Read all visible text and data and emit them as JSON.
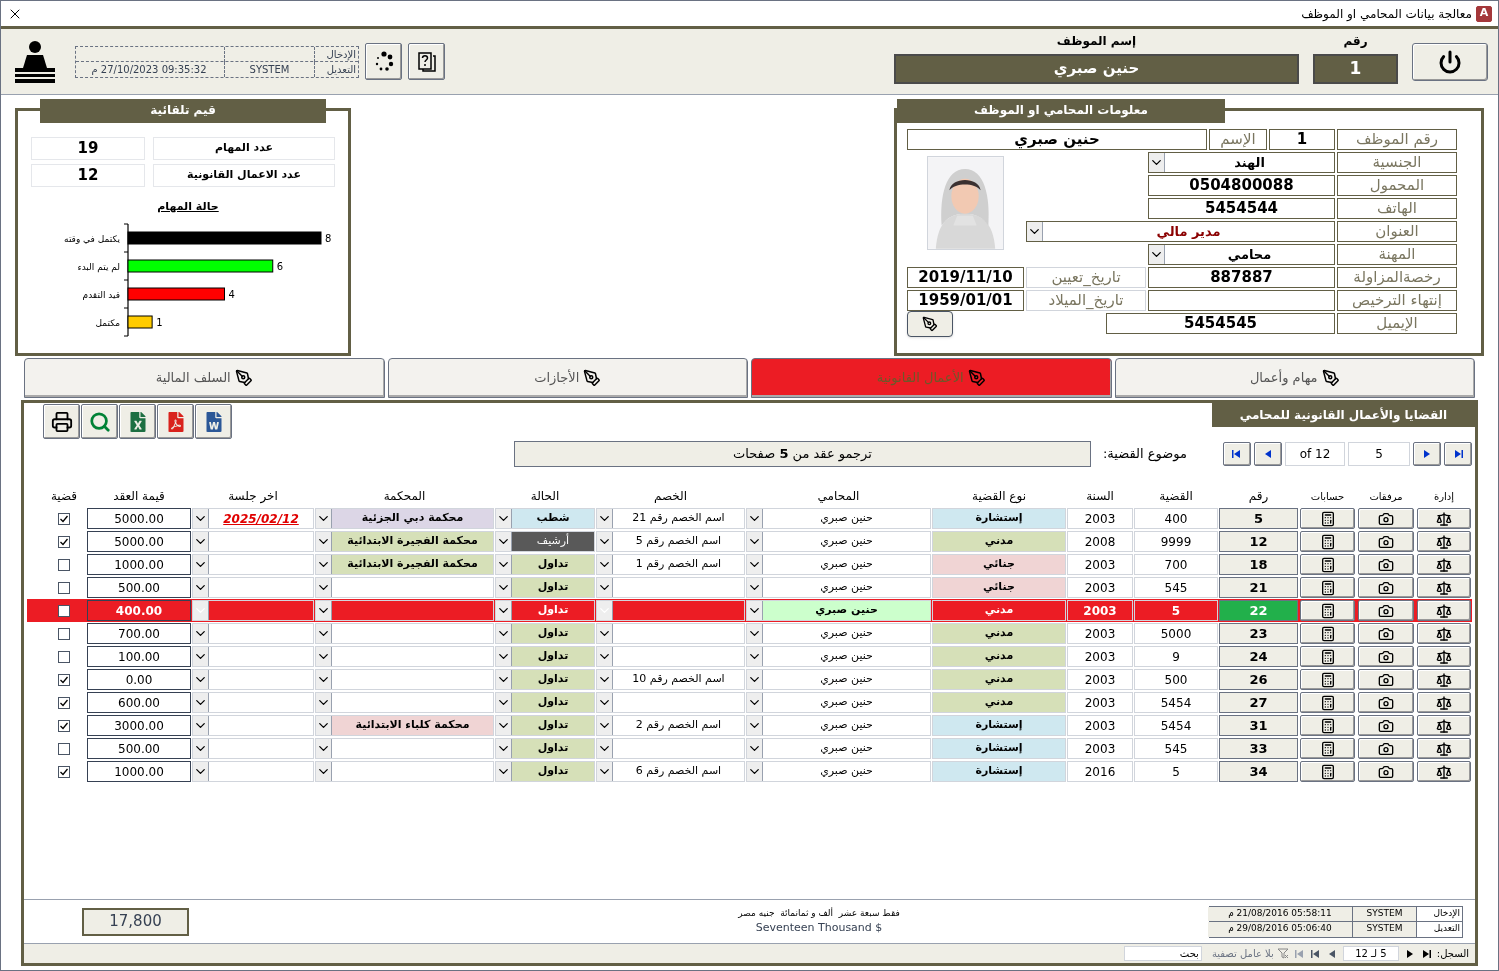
{
  "window": {
    "icon_letter": "A",
    "title": "معالجة بيانات المحامي او الموظف"
  },
  "header": {
    "number_label": "رقم",
    "number": "1",
    "name_label": "إسم الموظف",
    "name": "حنين صبري",
    "audit": [
      {
        "label": "الإدخال"
      },
      {
        "label": "التعديل",
        "user": "SYSTEM",
        "time": "09:35:32 27/10/2023 م"
      }
    ]
  },
  "stats_panel": {
    "title": "قيم تلقائية",
    "stats": [
      {
        "label": "عدد المهام",
        "value": "19"
      },
      {
        "label": "عدد الاعمال القانونية",
        "value": "12"
      }
    ],
    "chart_data": {
      "type": "bar",
      "orientation": "horizontal",
      "title": "حالة المهام",
      "categories": [
        "يكتمل في وقته",
        "لم يتم البدء",
        "قيد التقدم",
        "مكتمل"
      ],
      "series": [
        {
          "values": [
            8,
            6,
            4,
            1
          ]
        }
      ],
      "colors": [
        "#000000",
        "#00ff00",
        "#ff0000",
        "#ffcc00"
      ],
      "data_labels": true
    }
  },
  "employee_panel": {
    "title": "معلومات المحامي او الموظف",
    "id": {
      "label": "رقم الموظف",
      "value": "1"
    },
    "name": {
      "label": "الإسم",
      "value": "حنين صبري"
    },
    "nationality": {
      "label": "الجنسية",
      "value": "الهند"
    },
    "mobile": {
      "label": "المحمول",
      "value": "0504800088"
    },
    "phone": {
      "label": "الهاتف",
      "value": "5454544"
    },
    "address": {
      "label": "العنوان",
      "value": "مدير مالي"
    },
    "profession": {
      "label": "المهنة",
      "value": "محامي"
    },
    "license": {
      "label": "رخصةالمزاولة",
      "value": "887887"
    },
    "license_expiry": {
      "label": "إنتهاء الترخيص"
    },
    "email": {
      "label": "الإيميل",
      "value": "5454545"
    },
    "hire_date": {
      "label": "تاريخ_تعيين",
      "value": "2019/11/10"
    },
    "birth_date": {
      "label": "تاريخ_الميلاد",
      "value": "1959/01/01"
    }
  },
  "tabs": [
    {
      "label": "مهام وأعمال",
      "selected": false
    },
    {
      "label": "الأعمال القانونية",
      "selected": true
    },
    {
      "label": "الأجازات",
      "selected": false
    },
    {
      "label": "السلف المالية",
      "selected": false
    }
  ],
  "cases": {
    "title": "القضايا والأعمال القانونية للمحامي",
    "pager": {
      "of": "of 12",
      "current": "5"
    },
    "subject": {
      "label": "موضوع القضية:",
      "value": "ترجمو عقد من **5** صفحات"
    },
    "columns": [
      "إدارة",
      "مرفقات",
      "حسابات",
      "رقم",
      "القضية",
      "السنة",
      "نوع القضية",
      "المحامي",
      "الخصم",
      "الحالة",
      "المحكمة",
      "اخر جلسة",
      "قيمة العقد",
      "قضية"
    ],
    "rows": [
      {
        "number": "5",
        "case": "400",
        "year": "2003",
        "type": {
          "text": "إستشارة",
          "color": "#cfe8f0"
        },
        "lawyer": "حنين صبري",
        "opponent": "اسم الخصم رقم 21",
        "status": {
          "text": "شطب",
          "color": "#cfe8f0"
        },
        "court": {
          "text": "محكمة دبي الجزئية",
          "color": "#dcd6e6"
        },
        "last_session": "2025/02/12",
        "value": "5000.00",
        "checked": true,
        "selected": false
      },
      {
        "number": "12",
        "case": "9999",
        "year": "2008",
        "type": {
          "text": "مدني",
          "color": "#d6e0b8"
        },
        "lawyer": "حنين صبري",
        "opponent": "اسم الخصم رقم 5",
        "status": {
          "text": "أرشيف",
          "color": "#595959"
        },
        "court": {
          "text": "محكمة الفجيرة الابتدائية",
          "color": "#d6e0b8"
        },
        "value": "5000.00",
        "checked": true,
        "selected": false
      },
      {
        "number": "18",
        "case": "700",
        "year": "2003",
        "type": {
          "text": "جنائي",
          "color": "#f0d4d4"
        },
        "lawyer": "حنين صبري",
        "opponent": "اسم الخصم رقم 1",
        "status": {
          "text": "تداول",
          "color": "#d6e0b8"
        },
        "court": {
          "text": "محكمة الفجيرة الابتدائية",
          "color": "#d6e0b8"
        },
        "value": "1000.00",
        "checked": false,
        "selected": false
      },
      {
        "number": "21",
        "case": "545",
        "year": "2003",
        "type": {
          "text": "جنائي",
          "color": "#f0d4d4"
        },
        "lawyer": "حنين صبري",
        "status": {
          "text": "تداول",
          "color": "#d6e0b8"
        },
        "value": "500.00",
        "checked": false,
        "selected": false
      },
      {
        "number": "22",
        "case": "5",
        "year": "2003",
        "type": {
          "text": "مدني"
        },
        "lawyer": "حنين صبري",
        "status": {
          "text": "تداول"
        },
        "value": "400.00",
        "checked": false,
        "selected": true
      },
      {
        "number": "23",
        "case": "5000",
        "year": "2003",
        "type": {
          "text": "مدني",
          "color": "#d6e0b8"
        },
        "lawyer": "حنين صبري",
        "status": {
          "text": "تداول",
          "color": "#d6e0b8"
        },
        "value": "700.00",
        "checked": false,
        "selected": false
      },
      {
        "number": "24",
        "case": "9",
        "year": "2003",
        "type": {
          "text": "مدني",
          "color": "#d6e0b8"
        },
        "lawyer": "حنين صبري",
        "status": {
          "text": "تداول",
          "color": "#d6e0b8"
        },
        "value": "100.00",
        "checked": false,
        "selected": false
      },
      {
        "number": "26",
        "case": "500",
        "year": "2003",
        "type": {
          "text": "مدني",
          "color": "#d6e0b8"
        },
        "lawyer": "حنين صبري",
        "opponent": "اسم الخصم رقم 10",
        "status": {
          "text": "تداول",
          "color": "#d6e0b8"
        },
        "value": "0.00",
        "checked": true,
        "selected": false
      },
      {
        "number": "27",
        "case": "5454",
        "year": "2003",
        "type": {
          "text": "مدني",
          "color": "#d6e0b8"
        },
        "lawyer": "حنين صبري",
        "status": {
          "text": "تداول",
          "color": "#d6e0b8"
        },
        "value": "600.00",
        "checked": true,
        "selected": false
      },
      {
        "number": "31",
        "case": "5454",
        "year": "2003",
        "type": {
          "text": "إستشارة",
          "color": "#cfe8f0"
        },
        "lawyer": "حنين صبري",
        "opponent": "اسم الخصم رقم 2",
        "status": {
          "text": "تداول",
          "color": "#d6e0b8"
        },
        "court": {
          "text": "محكمة كلباء الابتدائية",
          "color": "#f0d4d4"
        },
        "value": "3000.00",
        "checked": true,
        "selected": false
      },
      {
        "number": "33",
        "case": "545",
        "year": "2003",
        "type": {
          "text": "إستشارة",
          "color": "#cfe8f0"
        },
        "lawyer": "حنين صبري",
        "status": {
          "text": "تداول",
          "color": "#d6e0b8"
        },
        "value": "500.00",
        "checked": false,
        "selected": false
      },
      {
        "number": "34",
        "case": "5",
        "year": "2016",
        "type": {
          "text": "إستشارة",
          "color": "#cfe8f0"
        },
        "lawyer": "حنين صبري",
        "opponent": "اسم الخصم رقم 6",
        "status": {
          "text": "تداول",
          "color": "#d6e0b8"
        },
        "value": "1000.00",
        "checked": true,
        "selected": false
      }
    ],
    "total": "17,800",
    "amount_words_ar": "فقط سبعة عشر  ألف و ثمانمائة  جنيه مصر",
    "amount_words_en": "Seventeen Thousand $",
    "audit": [
      {
        "label": "الإدخال",
        "user": "SYSTEM",
        "time": "05:58:11 21/08/2016 م"
      },
      {
        "label": "التعديل",
        "user": "SYSTEM",
        "time": "05:06:40 29/08/2016 م"
      }
    ],
    "record_nav": {
      "label": "السجل:",
      "position": "5 لـ 12",
      "filter": "بلا عامل تصفية",
      "search_placeholder": "بحث"
    }
  }
}
